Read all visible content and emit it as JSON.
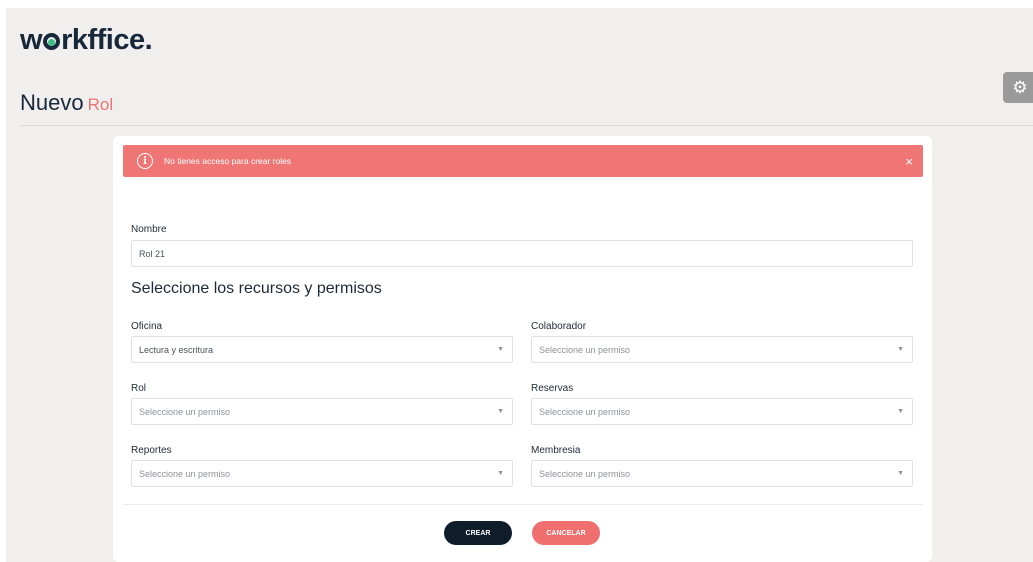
{
  "brand": {
    "logo_left": "w",
    "logo_right": "rkffice."
  },
  "header": {
    "title_main": "Nuevo",
    "title_accent": "Rol"
  },
  "settings": {
    "icon": "gear-icon"
  },
  "alert": {
    "icon": "info-icon",
    "message": "No tienes acceso para crear roles",
    "close_label": "×"
  },
  "form": {
    "name_label": "Nombre",
    "name_value": "Rol 21",
    "section_title": "Seleccione los recursos y permisos",
    "permissions": {
      "oficina": {
        "label": "Oficina",
        "value": "Lectura y escritura"
      },
      "colaborador": {
        "label": "Colaborador",
        "placeholder": "Seleccione un permiso"
      },
      "rol": {
        "label": "Rol",
        "placeholder": "Seleccione un permiso"
      },
      "reservas": {
        "label": "Reservas",
        "placeholder": "Seleccione un permiso"
      },
      "reportes": {
        "label": "Reportes",
        "placeholder": "Seleccione un permiso"
      },
      "membresia": {
        "label": "Membresia",
        "placeholder": "Seleccione un permiso"
      }
    }
  },
  "actions": {
    "create_label": "CREAR",
    "cancel_label": "CANCELAR"
  },
  "colors": {
    "accent": "#ee7372",
    "brand_dark": "#16283a",
    "alert_bg": "#f07676",
    "logo_green": "#3cbf85"
  }
}
